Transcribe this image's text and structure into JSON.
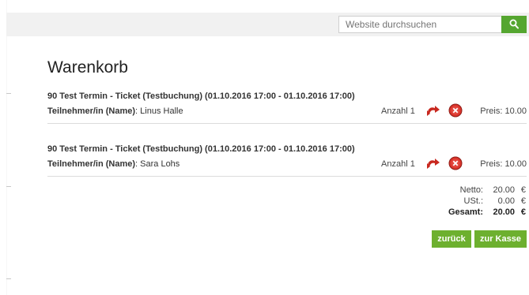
{
  "search": {
    "placeholder": "Website durchsuchen",
    "button_icon": "search-icon"
  },
  "cart": {
    "title": "Warenkorb",
    "items": [
      {
        "title": "90 Test Termin - Ticket (Testbuchung) (01.10.2016 17:00 - 01.10.2016 17:00)",
        "participant_label": "Teilnehmer/in (Name)",
        "participant_name": ": Linus Halle",
        "qty_label": "Anzahl",
        "qty": "1",
        "price": "Preis: 10.00"
      },
      {
        "title": "90 Test Termin - Ticket (Testbuchung) (01.10.2016 17:00 - 01.10.2016 17:00)",
        "participant_label": "Teilnehmer/in (Name)",
        "participant_name": ": Sara Lohs",
        "qty_label": "Anzahl",
        "qty": "1",
        "price": "Preis: 10.00"
      }
    ],
    "totals": {
      "netto_label": "Netto:",
      "netto_value": "20.00",
      "netto_currency": "€",
      "ust_label": "USt.:",
      "ust_value": "0.00",
      "ust_currency": "€",
      "gesamt_label": "Gesamt:",
      "gesamt_value": "20.00",
      "gesamt_currency": "€"
    },
    "buttons": {
      "back": "zurück",
      "checkout": "zur Kasse"
    }
  },
  "colors": {
    "accent_green": "#6db02f",
    "search_green": "#55a630",
    "remove_red": "#d9342b",
    "refresh_red": "#c8281f"
  }
}
